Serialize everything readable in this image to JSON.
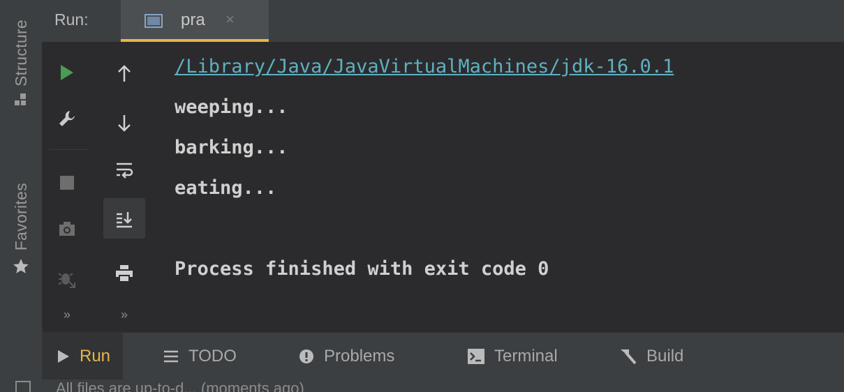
{
  "left_strip": {
    "structure_label": "Structure",
    "favorites_label": "Favorites"
  },
  "run_panel": {
    "label": "Run:",
    "tab_title": "pra",
    "tab_close": "×"
  },
  "toolbar": {
    "col1_icons": [
      "run-icon",
      "wrench-icon",
      "stop-icon",
      "camera-icon",
      "bug-icon"
    ],
    "col2_icons": [
      "arrow-up-icon",
      "arrow-down-icon",
      "soft-wrap-icon",
      "scroll-to-end-icon",
      "print-icon"
    ],
    "more": "»"
  },
  "console": {
    "lines": [
      "/Library/Java/JavaVirtualMachines/jdk-16.0.1",
      "weeping...",
      "barking...",
      "eating...",
      "",
      "Process finished with exit code 0"
    ]
  },
  "bottom_tabs": [
    {
      "label": "Run",
      "icon": "play-icon",
      "active": true
    },
    {
      "label": "TODO",
      "icon": "list-icon",
      "active": false
    },
    {
      "label": "Problems",
      "icon": "alert-icon",
      "active": false
    },
    {
      "label": "Terminal",
      "icon": "terminal-icon",
      "active": false
    },
    {
      "label": "Build",
      "icon": "hammer-icon",
      "active": false
    }
  ],
  "status": {
    "text": "All files are up-to-d... (moments ago)"
  },
  "colors": {
    "accent": "#e7b548",
    "run_green": "#499c54",
    "link": "#5fb0c2",
    "panel_bg": "#2b2b2d",
    "chrome_bg": "#3c3f41"
  }
}
